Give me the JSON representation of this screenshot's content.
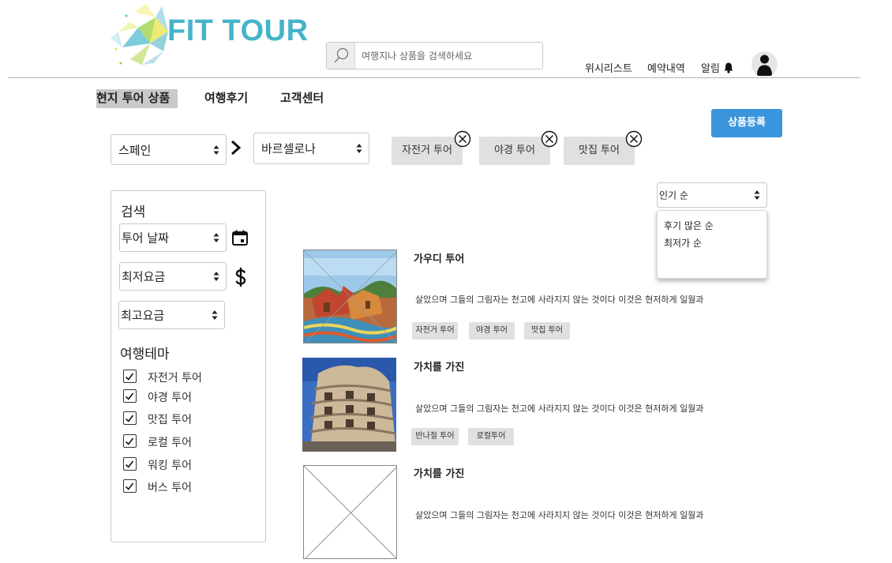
{
  "header": {
    "logo_text": "FIT TOUR",
    "search_placeholder": "여행지나 상품을 검색하세요",
    "nav": {
      "wishlist": "위시리스트",
      "reservations": "예약내역",
      "alerts": "알림"
    }
  },
  "tabs": [
    {
      "label": "현지 투어 상품",
      "active": true
    },
    {
      "label": "여행후기",
      "active": false
    },
    {
      "label": "고객센터",
      "active": false
    }
  ],
  "register_button": "상품등록",
  "filters": {
    "country": "스페인",
    "city": "바르셀로나",
    "chips": [
      "자전거 투어",
      "야경 투어",
      "맛집 투어"
    ]
  },
  "sidebar": {
    "search_heading": "검색",
    "date_select": "투어 날짜",
    "min_price_select": "최저요금",
    "max_price_select": "최고요금",
    "theme_heading": "여행테마",
    "themes": [
      {
        "label": "자전거 투어",
        "checked": true
      },
      {
        "label": "야경 투어",
        "checked": true
      },
      {
        "label": "맛집 투어",
        "checked": true
      },
      {
        "label": "로컬 투어",
        "checked": true
      },
      {
        "label": "워킹 투어",
        "checked": true
      },
      {
        "label": "버스 투어",
        "checked": true
      }
    ]
  },
  "sort": {
    "selected": "인기 순",
    "options": [
      "후기 많은 순",
      "최저가 순"
    ]
  },
  "tours": [
    {
      "title": "가우디 투어",
      "description": "살았으며 그들의 그림자는 천고에 사라지지 않는 것이다 이것은 현저하게 일월과",
      "tags": [
        "자전거 투어",
        "야경 투어",
        "맛집 투어"
      ],
      "image": "park-guell-photo"
    },
    {
      "title": "가치를 가진",
      "description": "살았으며 그들의 그림자는 천고에 사라지지 않는 것이다 이것은 현저하게 일월과",
      "tags": [
        "반나절 투어",
        "로컬투어"
      ],
      "image": "casa-mila-photo"
    },
    {
      "title": "가치를 가진",
      "description": "살았으며 그들의 그림자는 천고에 사라지지 않는 것이다 이것은 현저하게 일월과",
      "tags": [],
      "image": "placeholder-image"
    }
  ],
  "colors": {
    "brand": "#45b4c9",
    "primary_button": "#3b95dc",
    "chip_bg": "#e0e0e0"
  }
}
